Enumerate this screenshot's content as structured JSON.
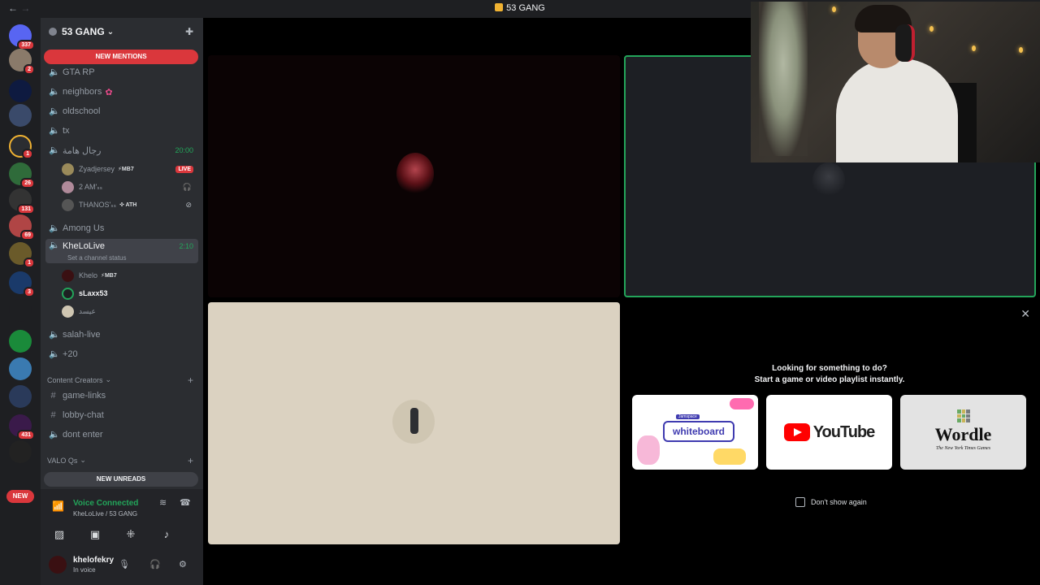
{
  "titlebar": {
    "back": "←",
    "forward": "→",
    "title": "53 GANG",
    "server_icon_label": "5⁴"
  },
  "servers": [
    {
      "badge": "337"
    },
    {
      "badge": "2"
    },
    {
      "badge": ""
    },
    {
      "badge": ""
    },
    {
      "badge": "1"
    },
    {
      "badge": "26"
    },
    {
      "badge": "131"
    },
    {
      "badge": "69"
    },
    {
      "badge": "1"
    },
    {
      "badge": "3"
    },
    {
      "badge": ""
    },
    {
      "badge": ""
    },
    {
      "badge": ""
    },
    {
      "badge": ""
    },
    {
      "badge": "431"
    },
    {
      "badge": ""
    }
  ],
  "new_pill": "NEW",
  "guild": {
    "name": "53 GANG",
    "chevron": "⌄"
  },
  "new_mentions": "NEW MENTIONS",
  "new_unreads": "NEW UNREADS",
  "channels": {
    "gta": "GTA RP",
    "neighbors": "neighbors",
    "neighbors_emoji": "✿",
    "oldschool": "oldschool",
    "tx": "tx",
    "arabic": "رجال هامة",
    "arabic_time": "20:00",
    "among": "Among Us",
    "khelolive": "KheLoLive",
    "khelolive_time": "2:10",
    "khelolive_status": "Set a channel status",
    "salah": "salah-live",
    "plus20": "+20",
    "game_links": "game-links",
    "lobby": "lobby-chat",
    "dont_enter": "dont enter"
  },
  "members_arabic": [
    {
      "name": "Zyadjersey",
      "tag": "⚡MB7",
      "live": "LIVE"
    },
    {
      "name": "2 AM'ₛₛ",
      "tag": ""
    },
    {
      "name": "THANOS'ₛₛ",
      "tag": "✜ ATH"
    }
  ],
  "members_khelo": [
    {
      "name": "Khelo",
      "tag": "⚡MB7"
    },
    {
      "name": "sLaxx53",
      "tag": ""
    },
    {
      "name": "عيسد",
      "tag": ""
    }
  ],
  "categories": {
    "content_creators": "Content Creators",
    "valo": "VALO Qs"
  },
  "voice": {
    "status": "Voice Connected",
    "location": "KheLoLive / 53 GANG"
  },
  "user": {
    "name": "khelofekry",
    "status": "In voice"
  },
  "activity": {
    "heading1": "Looking for something to do?",
    "heading2": "Start a game or video playlist instantly.",
    "whiteboard_tag": "Jamspace",
    "whiteboard_label": "whiteboard",
    "youtube_label": "YouTube",
    "wordle_label": "Wordle",
    "wordle_sub": "The New York Times Games",
    "dont_show": "Don't show again"
  },
  "colors": {
    "accent_red": "#da373c",
    "voice_green": "#23a55a"
  }
}
